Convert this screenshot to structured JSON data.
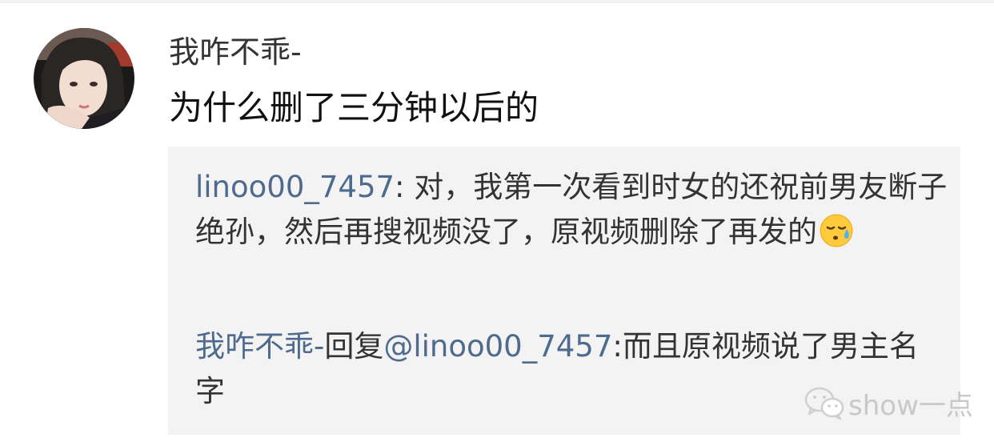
{
  "comment": {
    "username": "我咋不乖-",
    "text": "为什么删了三分钟以后的"
  },
  "replies": [
    {
      "author": "linoo00_7457",
      "separator": ": ",
      "text": "对，我第一次看到时女的还祝前男友断子绝孙，然后再搜视频没了，原视频删除了再发的",
      "emoji": "sad-relieved-face-emoji"
    },
    {
      "author": "我咋不乖-",
      "reply_word": "回复",
      "mention": "@linoo00_7457",
      "separator": ":",
      "text": "而且原视频说了男主名字"
    }
  ],
  "watermark": {
    "text": "show一点",
    "icon": "wechat-icon"
  },
  "colors": {
    "link": "#4e6b8e",
    "reply_background": "#f3f3f4",
    "text": "#333333"
  }
}
